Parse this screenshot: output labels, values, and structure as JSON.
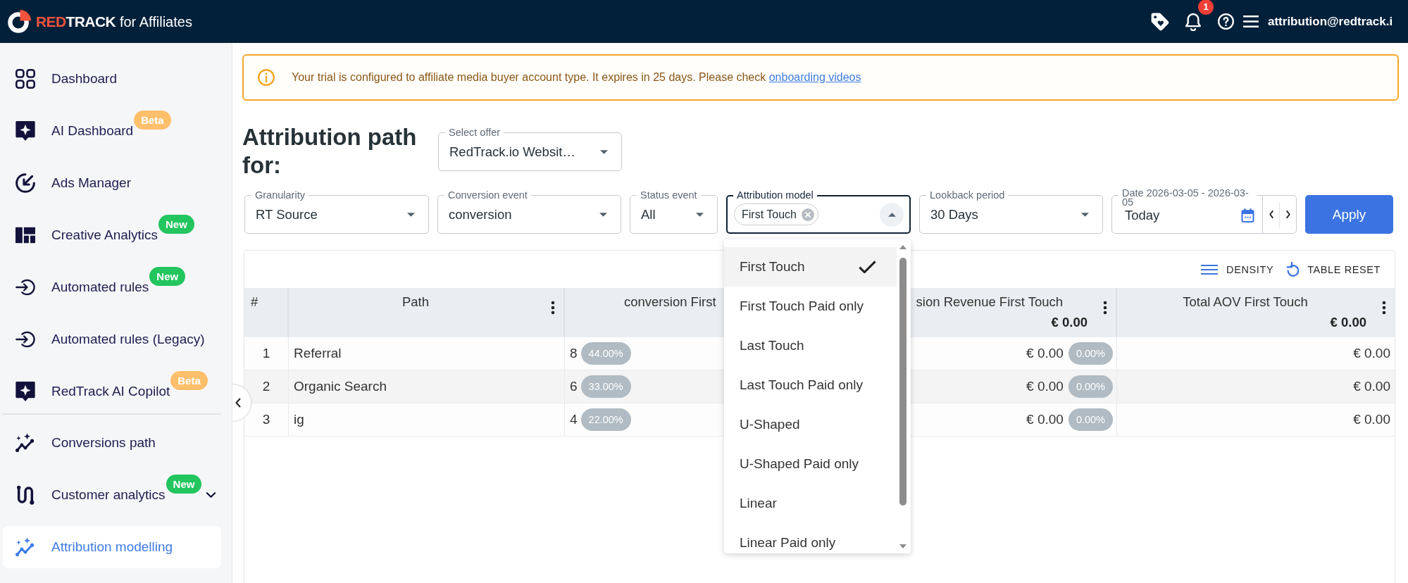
{
  "header": {
    "brand": {
      "accent": "RED",
      "rest": "TRACK",
      "suffix": "for Affiliates"
    },
    "notification_count": "1",
    "account": "attribution@redtrack.i"
  },
  "sidebar": {
    "sections": [
      {
        "items": [
          {
            "label": "Dashboard",
            "kind": "link",
            "selected": false
          },
          {
            "label": "AI Dashboard",
            "kind": "link",
            "selected": false,
            "badge": {
              "text": "Beta",
              "color": "#ffbf6b"
            }
          },
          {
            "label": "Ads Manager",
            "kind": "link",
            "selected": false
          },
          {
            "label": "Creative Analytics",
            "kind": "link",
            "selected": false,
            "badge": {
              "text": "New",
              "color": "#22c55e"
            }
          },
          {
            "label": "Automated rules",
            "kind": "link",
            "selected": false,
            "badge": {
              "text": "New",
              "color": "#22c55e"
            }
          },
          {
            "label": "Automated rules (Legacy)",
            "kind": "link",
            "selected": false
          },
          {
            "label": "RedTrack AI Copilot",
            "kind": "link",
            "selected": false,
            "badge": {
              "text": "Beta",
              "color": "#ffbf6b"
            }
          }
        ]
      },
      {
        "items": [
          {
            "label": "Conversions path",
            "kind": "link",
            "selected": false
          },
          {
            "label": "Customer analytics",
            "kind": "group",
            "expanded": false,
            "selected": false,
            "badge": {
              "text": "New",
              "color": "#22c55e"
            }
          },
          {
            "label": "Attribution modelling",
            "kind": "link",
            "selected": true
          }
        ]
      }
    ]
  },
  "notice": {
    "text": "Your trial is configured to affiliate media buyer account type. It expires in 25 days. Please check",
    "link": "onboarding videos"
  },
  "title": "Attribution path for:",
  "offer": {
    "label": "Select offer",
    "value": "RedTrack.io Websit…"
  },
  "filters": [
    {
      "kind": "select",
      "label": "Granularity",
      "value": "RT Source"
    },
    {
      "kind": "select",
      "label": "Conversion event",
      "value": "conversion"
    },
    {
      "kind": "select",
      "label": "Status event",
      "value": "All"
    },
    {
      "kind": "multiselect",
      "label": "Attribution model",
      "chips": [
        "First Touch"
      ],
      "open": true,
      "options": [
        {
          "label": "First Touch",
          "selected": true
        },
        {
          "label": "First Touch Paid only",
          "selected": false
        },
        {
          "label": "Last Touch",
          "selected": false
        },
        {
          "label": "Last Touch Paid only",
          "selected": false
        },
        {
          "label": "U-Shaped",
          "selected": false
        },
        {
          "label": "U-Shaped Paid only",
          "selected": false
        },
        {
          "label": "Linear",
          "selected": false
        },
        {
          "label": "Linear Paid only",
          "selected": false
        }
      ]
    },
    {
      "kind": "select",
      "label": "Lookback period",
      "value": "30 Days"
    },
    {
      "kind": "date",
      "label": "Date 2026-03-05 - 2026-03-05",
      "value": "Today"
    }
  ],
  "apply": "Apply",
  "table": {
    "tools": [
      "DENSITY",
      "TABLE RESET"
    ],
    "columns": [
      {
        "title": "#"
      },
      {
        "title": "Path",
        "menu": true
      },
      {
        "title": "conversion First"
      },
      {
        "title": "sion Revenue First Touch",
        "menu": true,
        "total": "€ 0.00"
      },
      {
        "title": "Total AOV First Touch",
        "menu": true,
        "total": "€ 0.00"
      }
    ],
    "rows": [
      {
        "number": "1",
        "path": "Referral",
        "conversions": {
          "value": "8",
          "share": "44.00%"
        },
        "revenue": {
          "value": "€ 0.00",
          "share": "0.00%"
        },
        "aov": "€ 0.00"
      },
      {
        "number": "2",
        "path": "Organic Search",
        "conversions": {
          "value": "6",
          "share": "33.00%"
        },
        "revenue": {
          "value": "€ 0.00",
          "share": "0.00%"
        },
        "aov": "€ 0.00"
      },
      {
        "number": "3",
        "path": "ig",
        "conversions": {
          "value": "4",
          "share": "22.00%"
        },
        "revenue": {
          "value": "€ 0.00",
          "share": "0.00%"
        },
        "aov": "€ 0.00"
      }
    ]
  }
}
